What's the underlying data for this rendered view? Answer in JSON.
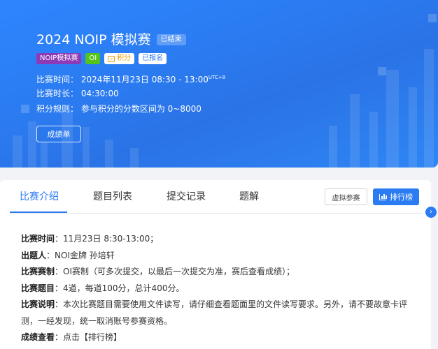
{
  "hero": {
    "title": "2024 NOIP 模拟赛",
    "status_badge": "已结束",
    "tags": [
      {
        "label": "NOIP模拟赛"
      },
      {
        "label": "OI"
      },
      {
        "label": "积分",
        "icon": "coin-icon"
      },
      {
        "label": "已报名"
      }
    ],
    "time_label": "比赛时间：",
    "time_value": "2024年11月23日 08:30 - 13:00",
    "timezone": "UTC+8",
    "duration_label": "比赛时长：",
    "duration_value": "04:30:00",
    "points_label": "积分规则：",
    "points_value": "参与积分的分数区间为 0~8000",
    "scores_button": "成绩单"
  },
  "tabs": [
    {
      "label": "比赛介绍",
      "active": true
    },
    {
      "label": "题目列表"
    },
    {
      "label": "提交记录"
    },
    {
      "label": "题解"
    }
  ],
  "actions": {
    "virtual_button": "虚拟参赛",
    "rank_button": "排行榜",
    "rank_icon": "bar-chart-icon"
  },
  "description": [
    {
      "label": "比赛时间",
      "value": "：11月23日 8:30-13:00；"
    },
    {
      "label": "出题人",
      "value": "：NOI金牌 孙培轩"
    },
    {
      "label": "比赛赛制",
      "value": "：OI赛制（可多次提交，以最后一次提交为准，赛后查看成绩）；"
    },
    {
      "label": "比赛题目",
      "value": "：4道，每道100分，总计400分。"
    },
    {
      "label": "比赛说明",
      "value": "：本次比赛题目需要使用文件读写，请仔细查看题面里的文件读写要求。另外，请不要故意卡评测，一经发现，统一取消账号参赛资格。"
    },
    {
      "label": "成绩查看",
      "value": "：点击【排行榜】"
    }
  ],
  "colors": {
    "accent": "#2b7cf2",
    "noip_tag": "#8e3ab6",
    "oi_tag": "#52c41a",
    "score_tag_text": "#e69b00"
  }
}
